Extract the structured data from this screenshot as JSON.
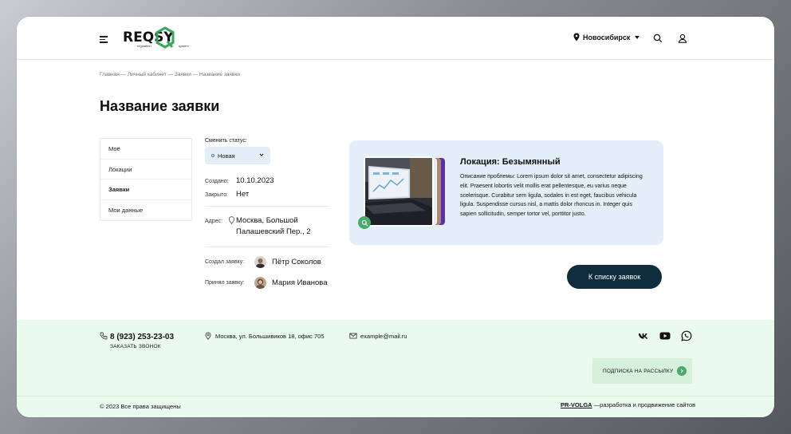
{
  "header": {
    "logo": {
      "text": "REQSY",
      "sub_left": "regulation",
      "sub_right": "system"
    },
    "city": "Новосибирск",
    "icons": [
      "menu-icon",
      "search-icon",
      "user-icon",
      "location-pin-icon"
    ]
  },
  "breadcrumb": "Главная — Личный кабинет — Заявки — Название заявки",
  "page_title": "Название заявки",
  "side_menu": {
    "items": [
      {
        "label": "Моё"
      },
      {
        "label": "Локации"
      },
      {
        "label": "Заявки",
        "active": true
      },
      {
        "label": "Мои данные"
      }
    ]
  },
  "details": {
    "status_label": "Сменить статус:",
    "status_value": "Новая",
    "created_label": "Создано:",
    "created_value": "10.10.2023",
    "closed_label": "Закрыто:",
    "closed_value": "Нет",
    "address_label": "Адрес:",
    "address_line1": "Москва, Большой",
    "address_line2": "Палашевский Пер., 2",
    "creator_label": "Создал заявку:",
    "creator_name": "Пётр Соколов",
    "acceptor_label": "Принял заявку:",
    "acceptor_name": "Мария Иванова"
  },
  "card": {
    "title": "Локация: Безымянный",
    "description": "Описание проблемы: Lorem ipsum dolor sit amet, consectetur adipiscing elit. Praesent lobortis velit mollis erat pellentesque, eu varius neque scelerisque. Curabitur sem ligula, sodales in est eget, faucibus vehicula ligula. Suspendisse cursus nisl, a mattis dolor rhoncus in. Integer quis sapien sollicitudin, semper tortor vel, porttitor justo."
  },
  "back_button": "К списку заявок",
  "footer": {
    "phone": "8 (923) 253-23-03",
    "callback": "ЗАКАЗАТЬ ЗВОНОК",
    "address": "Москва, ул. Большивиков 18, офис 705",
    "email": "example@mail.ru",
    "social": [
      "vk-icon",
      "youtube-icon",
      "whatsapp-icon"
    ],
    "subscribe": "ПОДПИСКА НА РАССЫЛКУ",
    "copyright": "© 2023 Все права защищены",
    "dev_name": "PR-VOLGA",
    "dev_text": " —разработка и продвижение сайтов"
  },
  "colors": {
    "accent_green": "#4aaa6a",
    "button_dark": "#0f2d3d",
    "card_bg": "#e3eef8",
    "footer_bg": "#ebfaef"
  }
}
